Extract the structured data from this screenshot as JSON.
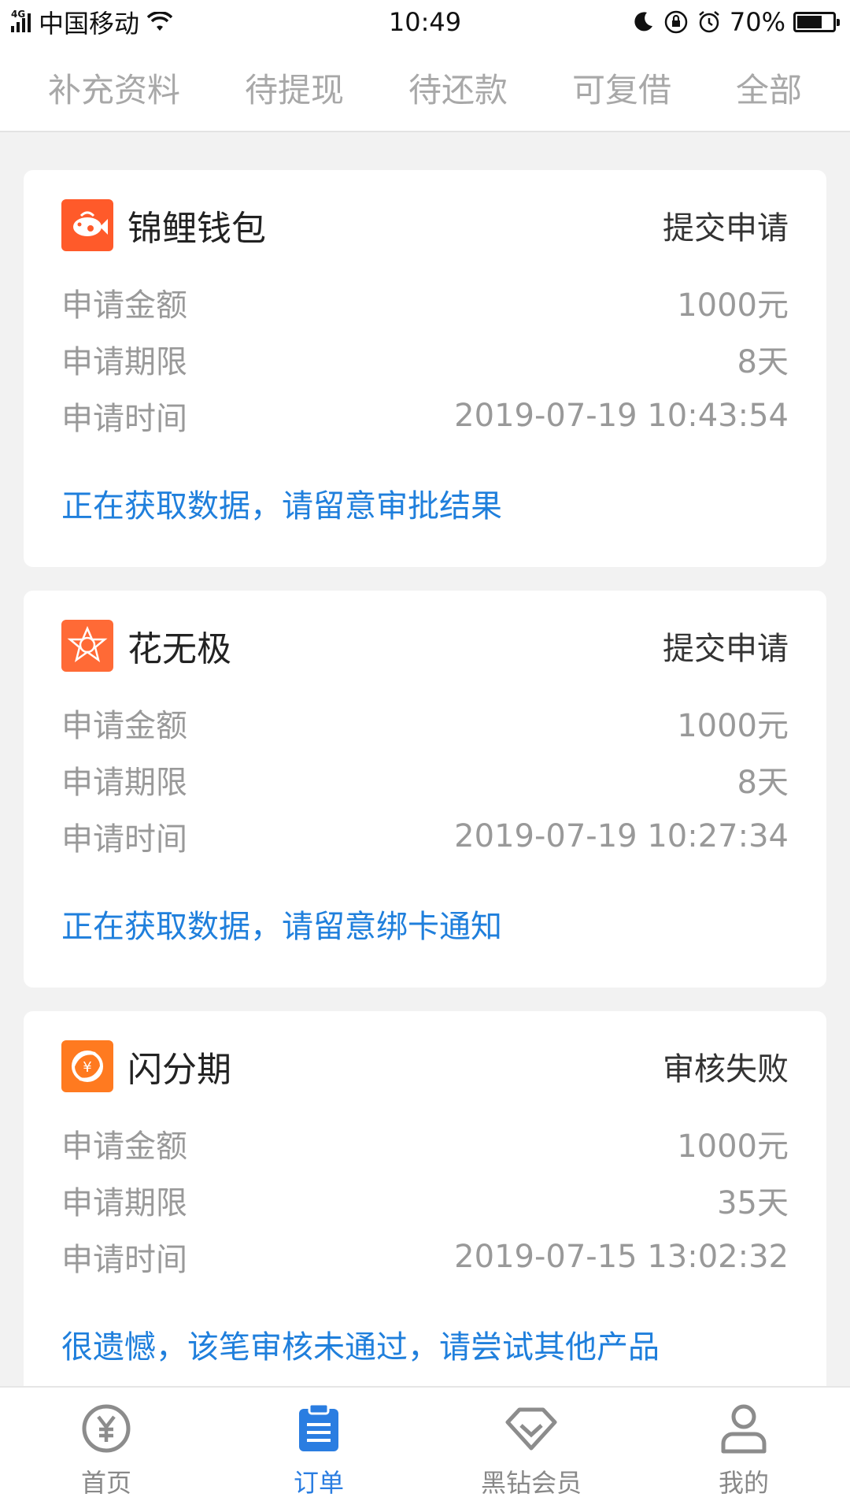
{
  "status_bar": {
    "network": "4G",
    "carrier": "中国移动",
    "time": "10:49",
    "battery_text": "70%",
    "battery_level": 0.7,
    "icons": [
      "wifi-icon",
      "moon-icon",
      "rotation-lock-icon",
      "alarm-icon",
      "battery-icon"
    ]
  },
  "tabs": [
    {
      "label": "补充资料",
      "active": false
    },
    {
      "label": "待提现",
      "active": false
    },
    {
      "label": "待还款",
      "active": false
    },
    {
      "label": "可复借",
      "active": false
    },
    {
      "label": "全部",
      "active": true
    }
  ],
  "orders": [
    {
      "name": "锦鲤钱包",
      "status": "提交申请",
      "logo_color": "#ff5a2a",
      "logo_icon": "koi-fish-icon",
      "rows": [
        {
          "label": "申请金额",
          "value": "1000元"
        },
        {
          "label": "申请期限",
          "value": "8天"
        },
        {
          "label": "申请时间",
          "value": "2019-07-19 10:43:54"
        }
      ],
      "note": "正在获取数据，请留意审批结果"
    },
    {
      "name": "花无极",
      "status": "提交申请",
      "logo_color": "#ff6a36",
      "logo_icon": "star-emblem-icon",
      "rows": [
        {
          "label": "申请金额",
          "value": "1000元"
        },
        {
          "label": "申请期限",
          "value": "8天"
        },
        {
          "label": "申请时间",
          "value": "2019-07-19 10:27:34"
        }
      ],
      "note": "正在获取数据，请留意绑卡通知"
    },
    {
      "name": "闪分期",
      "status": "审核失败",
      "logo_color": "#ff7a20",
      "logo_icon": "yuan-swirl-icon",
      "rows": [
        {
          "label": "申请金额",
          "value": "1000元"
        },
        {
          "label": "申请期限",
          "value": "35天"
        },
        {
          "label": "申请时间",
          "value": "2019-07-15 13:02:32"
        }
      ],
      "note": "很遗憾，该笔审核未通过，请尝试其他产品"
    }
  ],
  "bottom_nav": [
    {
      "label": "首页",
      "icon": "yuan-coin-icon",
      "active": false
    },
    {
      "label": "订单",
      "icon": "clipboard-icon",
      "active": true
    },
    {
      "label": "黑钻会员",
      "icon": "diamond-icon",
      "active": false
    },
    {
      "label": "我的",
      "icon": "user-icon",
      "active": false
    }
  ],
  "colors": {
    "accent": "#2a7de1",
    "note_blue": "#1f7fdc",
    "background": "#f2f2f2"
  }
}
